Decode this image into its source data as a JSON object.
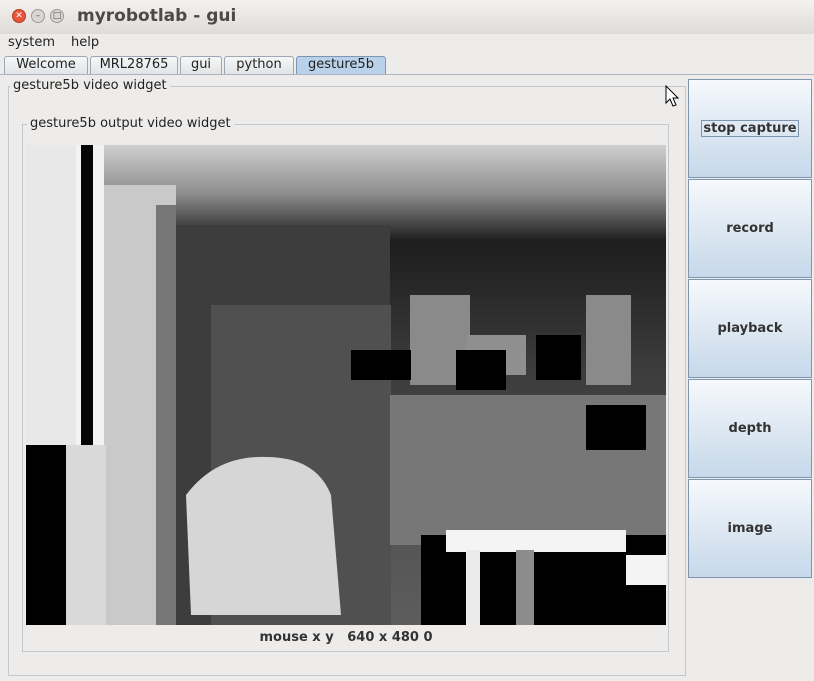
{
  "window": {
    "title": "myrobotlab - gui"
  },
  "menu": [
    "system",
    "help"
  ],
  "tabs": [
    {
      "label": "Welcome",
      "active": false
    },
    {
      "label": "MRL28765",
      "active": false
    },
    {
      "label": "gui",
      "active": false
    },
    {
      "label": "python",
      "active": false
    },
    {
      "label": "gesture5b",
      "active": true
    }
  ],
  "panel": {
    "title": "gesture5b  video widget",
    "output": {
      "title": "gesture5b output video widget",
      "mouse_label": "mouse x y",
      "mouse_value": "640 x 480 0"
    }
  },
  "buttons": [
    "stop capture",
    "record",
    "playback",
    "depth",
    "image"
  ],
  "colors": {
    "active_tab": "#b9d2ea",
    "button_top": "#f6f9fc",
    "button_bottom": "#c6d8ea",
    "close": "#e8573b"
  }
}
